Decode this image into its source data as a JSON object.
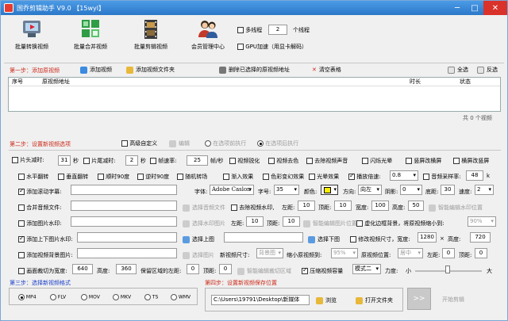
{
  "titlebar": {
    "title": "国乔剪辑助手 V9.0 【15wyl】"
  },
  "toolbar": {
    "batch_convert": "批量转换视频",
    "batch_merge": "批量合并视频",
    "batch_edit": "批量剪辑视频",
    "member_center": "会员管理中心",
    "multithread_label": "多线程",
    "thread_count": "2",
    "thread_unit": "个线程",
    "gpu_label": "GPU加速（用显卡解码）"
  },
  "step1": {
    "title": "第一步：添加原视频",
    "add_video": "添加视频",
    "add_folder": "添加视频文件夹",
    "delete_selected": "删除已选择的原视频地址",
    "clear_table": "清空表格",
    "select_all": "全选",
    "invert": "反选",
    "columns": [
      "序号",
      "原视频地址",
      "时长",
      "状态"
    ],
    "footer": "共 0 个视频"
  },
  "step2": {
    "title": "第二步：设置新视频选项",
    "advanced": "高级自定义",
    "edit": "编辑",
    "before": "在选项前执行",
    "after": "在选项后执行",
    "row1": {
      "head_cut": "片头减时:",
      "head_val": "31",
      "sec1": "秒",
      "tail_cut": "片尾减时:",
      "tail_val": "2",
      "sec2": "秒",
      "frame_rate": "帧速率:",
      "frame_val": "25",
      "fps_unit": "帧/秒",
      "sharpen": "视频锐化",
      "decolor": "视频去色",
      "remove_audio": "去除视频声音",
      "flash": "闪烁光晕",
      "vert_to_horiz": "竖屏改横屏",
      "horiz_to_vert": "横屏改竖屏"
    },
    "row2": {
      "hflip": "水平翻转",
      "vflip": "垂直翻转",
      "cw90": "顺时90度",
      "ccw90": "逆时90度",
      "random_transition": "随机转场",
      "fade_in": "渐入效果",
      "color_change": "色彩变幻效果",
      "light": "光晕效果",
      "speed": "播放倍速:",
      "speed_val": "0.8",
      "sample_rate": "音频采样率:",
      "sample_val": "48",
      "k": "k"
    },
    "row3": {
      "scroll_sub": "添加滚动字幕:",
      "font": "字体:",
      "font_val": "Adobe Caslon",
      "size": "字号:",
      "size_val": "35",
      "color": "颜色:",
      "color_hex": "#ffee00",
      "direction": "方向:",
      "direction_val": "向左",
      "shadow": "阴影:",
      "shadow_val": "0",
      "bottom": "底距:",
      "bottom_val": "30",
      "speed": "速度:",
      "speed_val": "2"
    },
    "row4": {
      "merge_audio": "合并音频文件:",
      "select_audio": "选择音频文件",
      "remove_watermark": "去除视频水印,",
      "left": "左距:",
      "left_val": "10",
      "top": "顶距:",
      "top_val": "10",
      "width": "宽度:",
      "width_val": "100",
      "height": "高度:",
      "height_val": "50",
      "smart_wm": "智能编辑水印位置"
    },
    "row5": {
      "add_image_wm": "添加图片水印:",
      "select_wm_image": "选择水印图片",
      "left": "左距:",
      "left_val": "10",
      "top": "顶距:",
      "top_val": "10",
      "smart_img": "智能编辑图片位置",
      "blur_bg": "虚化边框背景，将原视频缩小到:",
      "blur_val": "90%"
    },
    "row6": {
      "add_overlay": "添加上下图片水印:",
      "select_top": "选择上图",
      "select_bottom": "选择下图",
      "resize": "修改视频尺寸，宽度:",
      "w_val": "1280",
      "x": "×",
      "height": "高度:",
      "h_val": "720"
    },
    "row7": {
      "add_bg": "添加视频背景图片:",
      "select_image": "选择图片",
      "new_size": "新视频尺寸:",
      "new_size_val": "背景图",
      "shrink": "缩小原视频到:",
      "shrink_val": "95%",
      "position": "原视频位置:",
      "position_val": "居中",
      "left": "左距:",
      "left_val": "0",
      "top": "顶距:",
      "top_val": "0"
    },
    "row8": {
      "crop": "画面裁切为宽度:",
      "crop_w": "640",
      "height": "高度:",
      "crop_h": "360",
      "keep_left": "保留区域的左距:",
      "left_val": "0",
      "top": "顶距:",
      "top_val": "0",
      "smart_crop": "智能编辑裁切区域",
      "compress": "压缩视频容量",
      "mode": "模式二",
      "strength": "力度:",
      "small": "小",
      "large": "大"
    }
  },
  "step3": {
    "title": "第三步：选择新视频格式",
    "formats": [
      "MP4",
      "FLV",
      "MOV",
      "MKV",
      "TS",
      "WMV"
    ]
  },
  "step4": {
    "title": "第四步：设置新视频保存位置",
    "path": "C:\\Users\\19791\\Desktop\\新媒体",
    "browse": "浏览",
    "open_folder": "打开文件夹",
    "start": "开始剪辑"
  }
}
